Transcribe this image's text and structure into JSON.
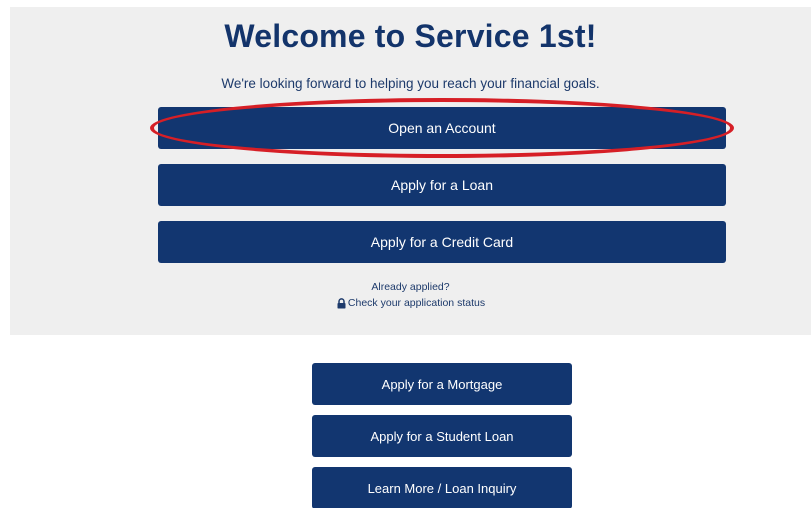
{
  "hero": {
    "title": "Welcome to Service 1st!",
    "subtitle": "We're looking forward to helping you reach your financial goals."
  },
  "primary_actions": {
    "open_account": "Open an Account",
    "apply_loan": "Apply for a Loan",
    "apply_credit_card": "Apply for a Credit Card"
  },
  "application_status": {
    "prompt": "Already applied?",
    "link_label": "Check your application status",
    "icon": "lock-icon"
  },
  "secondary_actions": {
    "apply_mortgage": "Apply for a Mortgage",
    "apply_student_loan": "Apply for a Student Loan",
    "learn_more": "Learn More / Loan Inquiry"
  },
  "colors": {
    "panel_background": "#efefef",
    "button_background": "#123670",
    "title_text": "#13346b",
    "highlight": "#d61f26"
  }
}
